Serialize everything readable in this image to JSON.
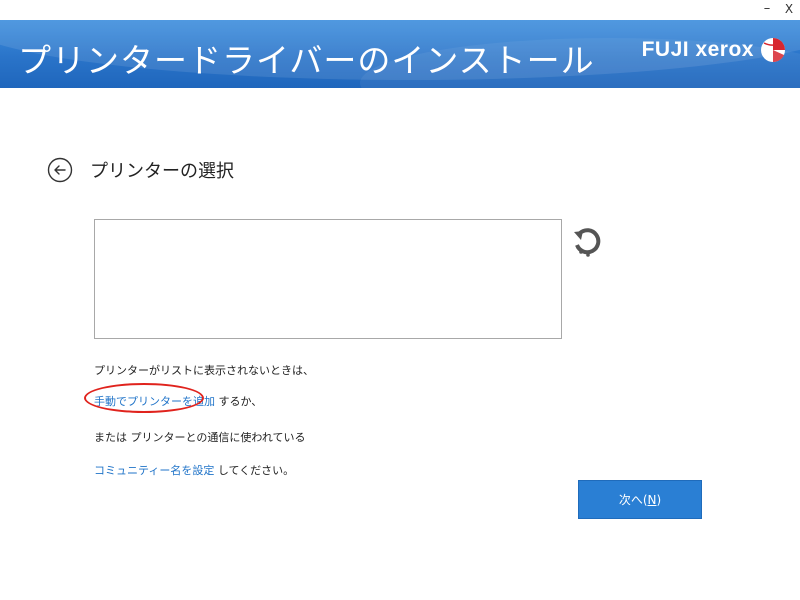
{
  "window_controls": {
    "minimize": "–",
    "close": "X"
  },
  "header": {
    "title": "プリンタードライバーのインストール",
    "brand": "FUJI xerox",
    "brand_color": "#2a74c9"
  },
  "page": {
    "title": "プリンターの選択",
    "back_icon": "back-arrow-circle-icon",
    "refresh_icon": "refresh-icon"
  },
  "help": {
    "line1": "プリンターがリストに表示されないときは、",
    "line2_link": "手動でプリンターを追加",
    "line2_suffix": " するか、",
    "line3": "または プリンターとの通信に使われている",
    "line4_link": "コミュニティー名を設定",
    "line4_suffix": " してください。"
  },
  "buttons": {
    "next_label": "次へ(",
    "next_mnemonic": "N",
    "next_close": ")"
  },
  "colors": {
    "link": "#1f73c8",
    "highlight": "#e0231d",
    "button": "#2a7fd4"
  }
}
